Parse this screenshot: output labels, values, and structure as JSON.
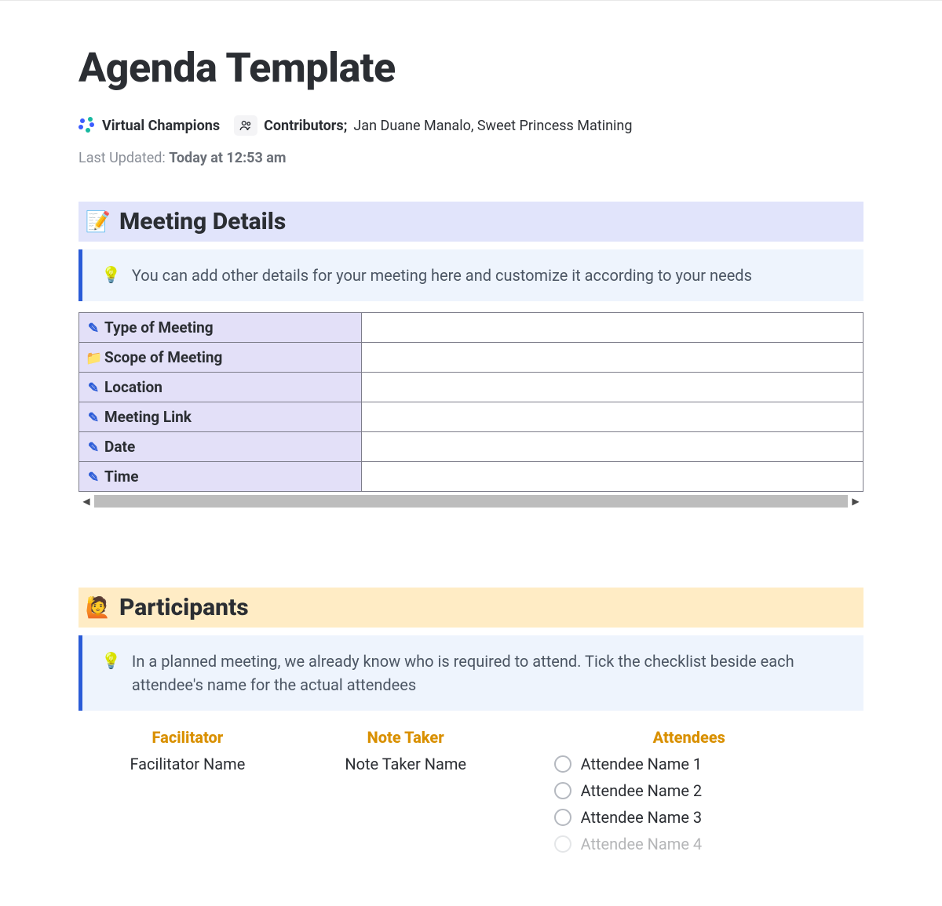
{
  "page": {
    "title": "Agenda Template",
    "team": "Virtual Champions",
    "contributors_label": "Contributors",
    "contributors_sep": ";",
    "contributors": "Jan Duane Manalo, Sweet Princess Matining",
    "last_updated_label": "Last Updated:",
    "last_updated_value": "Today at 12:53 am"
  },
  "meeting_details": {
    "heading": "Meeting Details",
    "callout": "You can add other details for your meeting here and customize it according to your needs",
    "rows": [
      {
        "icon": "pencil",
        "label": "Type of Meeting",
        "value": ""
      },
      {
        "icon": "folder",
        "label": "Scope of Meeting",
        "value": ""
      },
      {
        "icon": "pencil",
        "label": "Location",
        "value": ""
      },
      {
        "icon": "pencil",
        "label": "Meeting Link",
        "value": ""
      },
      {
        "icon": "pencil",
        "label": "Date",
        "value": ""
      },
      {
        "icon": "pencil",
        "label": "Time",
        "value": ""
      }
    ]
  },
  "participants": {
    "heading": "Participants",
    "callout": "In a planned meeting, we already know who is required to attend. Tick the checklist beside each attendee's name for the actual attendees",
    "facilitator_header": "Facilitator",
    "facilitator_name": "Facilitator Name",
    "notetaker_header": "Note Taker",
    "notetaker_name": "Note Taker Name",
    "attendees_header": "Attendees",
    "attendees": [
      "Attendee Name 1",
      "Attendee Name 2",
      "Attendee Name 3",
      "Attendee Name 4"
    ]
  }
}
